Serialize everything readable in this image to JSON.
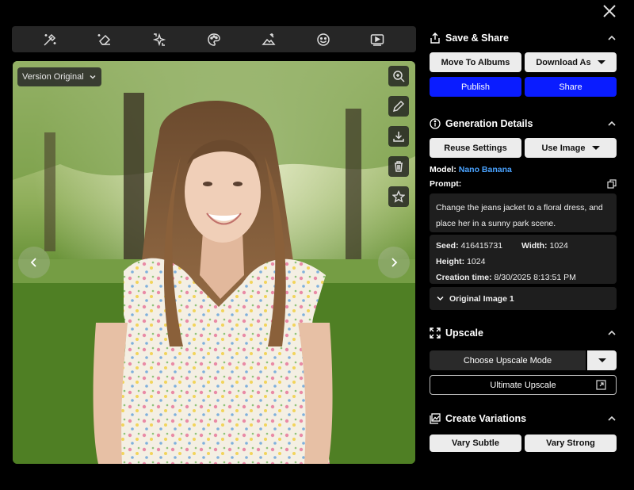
{
  "viewer": {
    "version_label": "Version Original"
  },
  "toolbar": {
    "tools": [
      "magic-wand-icon",
      "eraser-icon",
      "sparkle-icon",
      "palette-icon",
      "image-edit-icon",
      "smiley-icon",
      "video-icon"
    ]
  },
  "save_share": {
    "title": "Save & Share",
    "move_to_albums": "Move To Albums",
    "download_as": "Download As",
    "publish": "Publish",
    "share": "Share"
  },
  "generation": {
    "title": "Generation Details",
    "reuse_settings": "Reuse Settings",
    "use_image": "Use Image",
    "model_label": "Model:",
    "model_value": "Nano Banana",
    "prompt_label": "Prompt:",
    "prompt_text": "Change the jeans jacket to a floral dress, and place her in a sunny park scene.",
    "seed_label": "Seed:",
    "seed_value": "416415731",
    "width_label": "Width:",
    "width_value": "1024",
    "height_label": "Height:",
    "height_value": "1024",
    "creation_label": "Creation time:",
    "creation_value": "8/30/2025 8:13:51 PM",
    "original_image": "Original Image 1"
  },
  "upscale": {
    "title": "Upscale",
    "mode": "Choose Upscale Mode",
    "ultimate": "Ultimate Upscale"
  },
  "variations": {
    "title": "Create Variations",
    "subtle": "Vary Subtle",
    "strong": "Vary Strong"
  },
  "colors": {
    "accent_blue": "#0a1cff",
    "model_link": "#4aa3ff"
  }
}
